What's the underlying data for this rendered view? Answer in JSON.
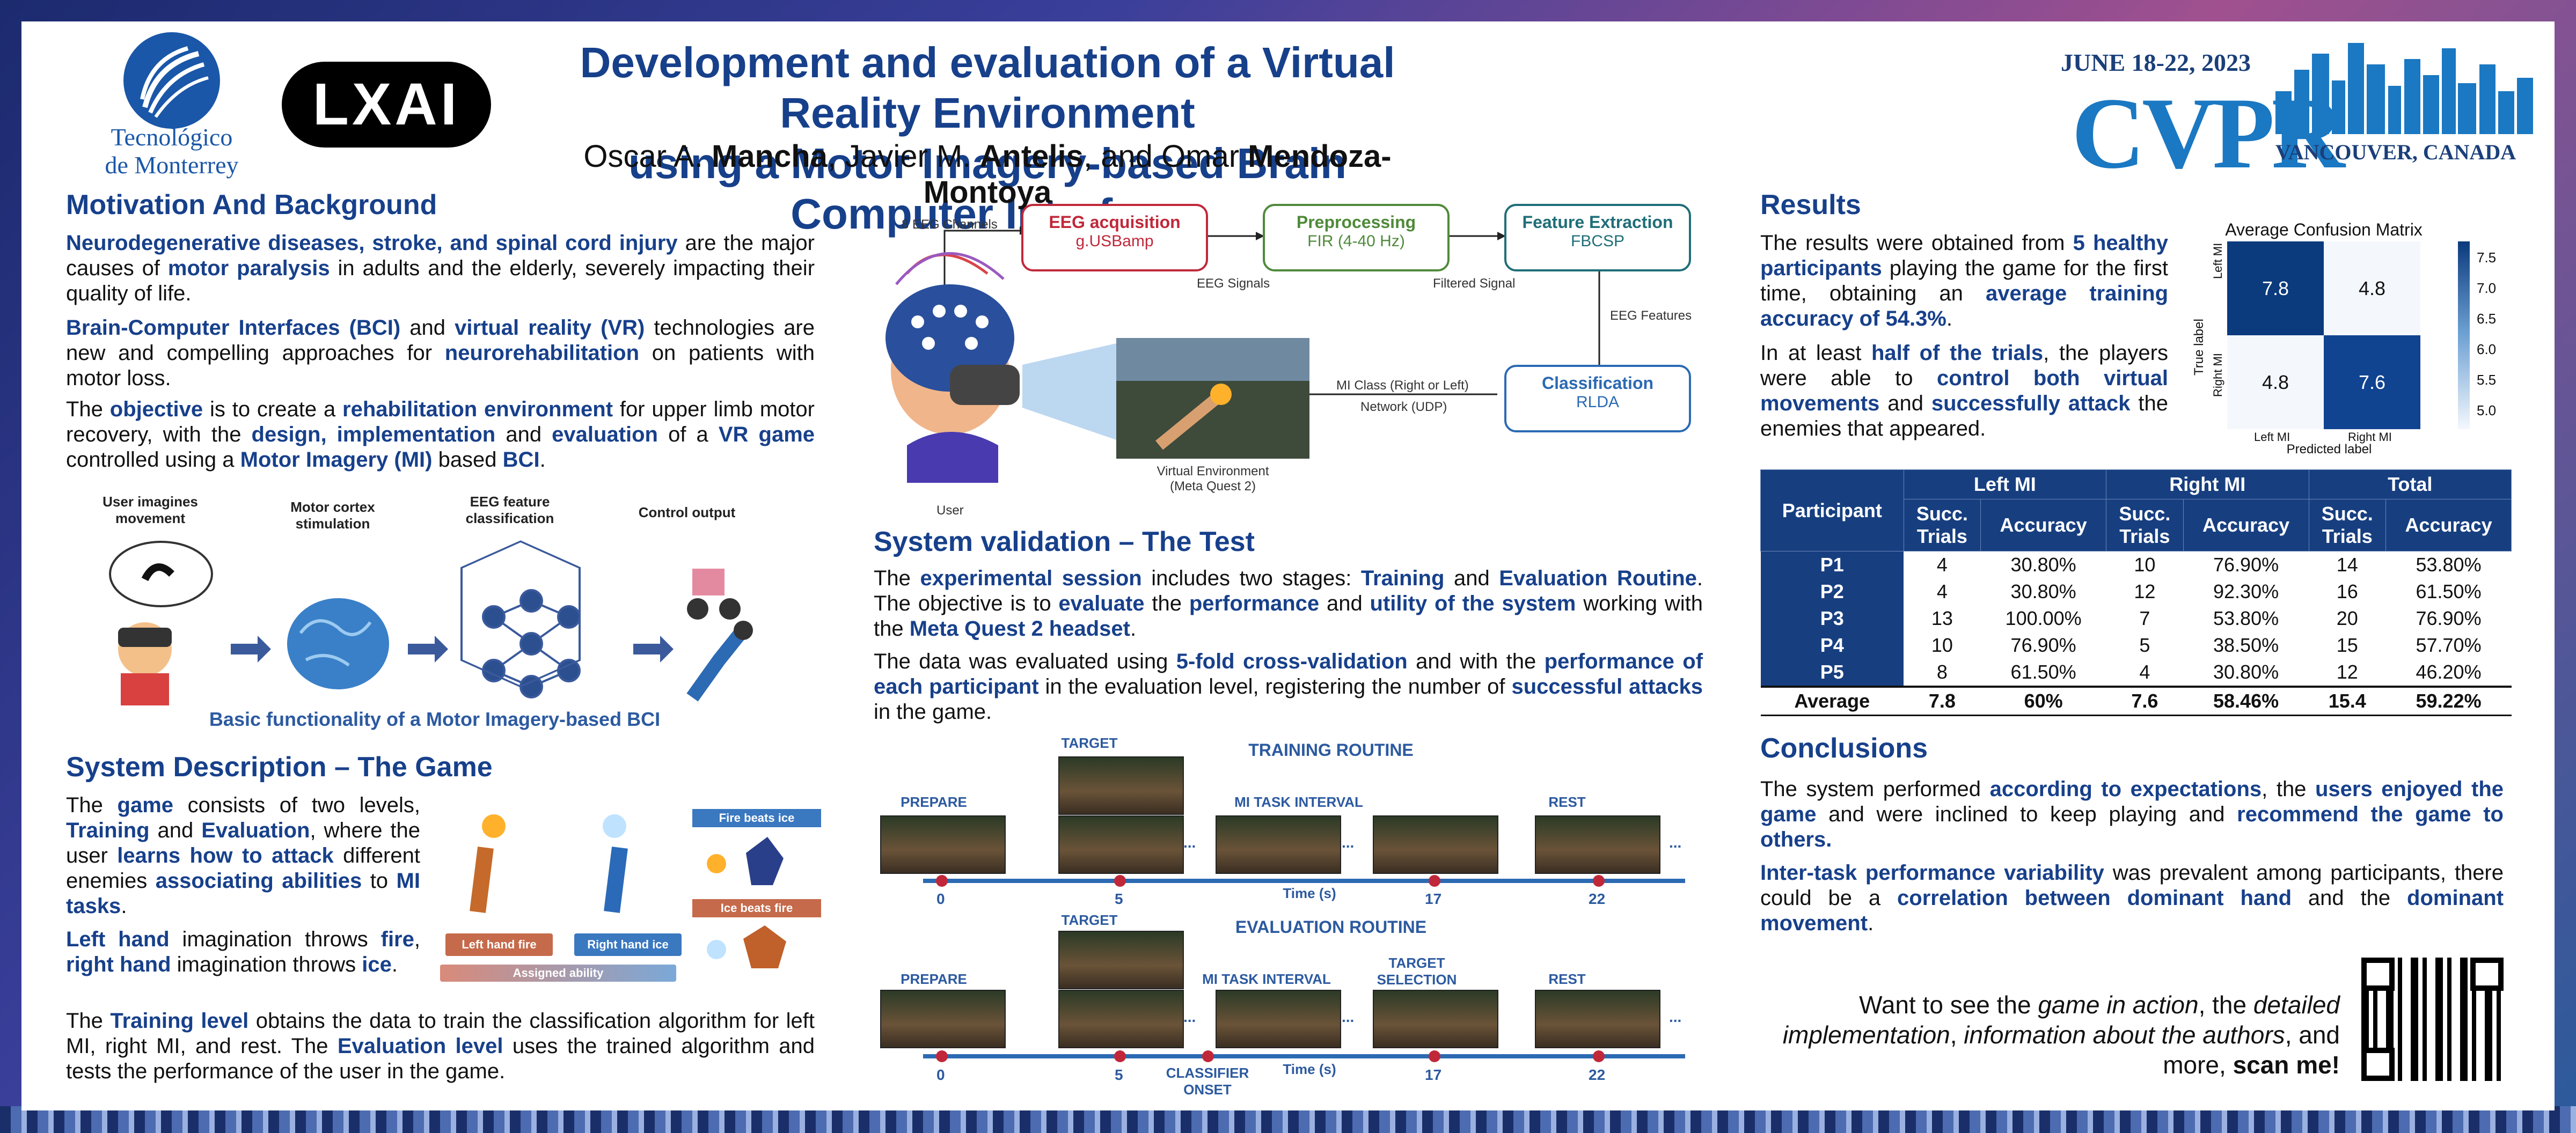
{
  "header": {
    "title_line1": "Development and evaluation of a Virtual Reality Environment",
    "title_line2": "using a Motor Imagery-based Brain Computer Interface",
    "authors": [
      {
        "first": "Oscar A.",
        "last": "Mancha"
      },
      {
        "first": "Javier M.",
        "last": "Antelis"
      },
      {
        "first": "Omar",
        "last": "Mendoza-Montoya"
      }
    ],
    "author_sep1": ", ",
    "author_sep2": ", and ",
    "logo_tec_line1": "Tecnológico",
    "logo_tec_line2": "de Monterrey",
    "logo_lxai": "LXAI",
    "conf_date": "JUNE 18-22, 2023",
    "conf_name": "CVPR",
    "conf_city": "VANCOUVER, CANADA"
  },
  "motivation": {
    "heading": "Motivation And Background",
    "p1_a": "Neurodegenerative diseases, stroke, and spinal cord injury",
    "p1_b": " are the major causes of ",
    "p1_c": "motor paralysis",
    "p1_d": " in adults and the elderly, severely impacting their quality of life.",
    "p2_a": "Brain-Computer Interfaces (BCI)",
    "p2_b": " and ",
    "p2_c": "virtual reality (VR)",
    "p2_d": " technologies are new and compelling approaches for ",
    "p2_e": "neurorehabilitation",
    "p2_f": " on patients with motor loss.",
    "p3_a": "The ",
    "p3_b": "objective",
    "p3_c": " is to create a ",
    "p3_d": "rehabilitation environment",
    "p3_e": " for upper limb motor recovery, with the ",
    "p3_f": "design, implementation",
    "p3_g": " and ",
    "p3_h": "evaluation",
    "p3_i": " of a ",
    "p3_j": "VR game",
    "p3_k": " controlled using a ",
    "p3_l": "Motor Imagery (MI)",
    "p3_m": " based ",
    "p3_n": "BCI",
    "p3_o": "."
  },
  "mi_figure": {
    "label1": "User imagines movement",
    "label2": "Motor cortex stimulation",
    "label3": "EEG feature classification",
    "label4": "Control output",
    "caption": "Basic functionality of a Motor Imagery-based BCI"
  },
  "game": {
    "heading": "System Description – The Game",
    "p1_a": "The ",
    "p1_b": "game",
    "p1_c": " consists of two levels, ",
    "p1_d": "Training",
    "p1_e": " and ",
    "p1_f": "Evaluation",
    "p1_g": ", where the user ",
    "p1_h": "learns how to attack",
    "p1_i": " different enemies ",
    "p1_j": "associating abilities",
    "p1_k": " to ",
    "p1_l": "MI tasks",
    "p1_m": ".",
    "p2_a": "Left hand",
    "p2_b": " imagination throws ",
    "p2_c": "fire",
    "p2_d": ", ",
    "p2_e": "right hand",
    "p2_f": " imagination throws ",
    "p2_g": "ice",
    "p2_h": ".",
    "p3_a": "The ",
    "p3_b": "Training level",
    "p3_c": " obtains the data to train the classification algorithm for left MI, right MI, and rest. The ",
    "p3_d": "Evaluation level",
    "p3_e": " uses the trained algorithm and tests the performance of the user in the game.",
    "fig_left": "Left hand fire",
    "fig_right": "Right hand ice",
    "fig_assigned": "Assigned ability",
    "fig_fire_beats": "Fire beats ice",
    "fig_ice_beats": "Ice beats fire"
  },
  "system": {
    "channels": "8 EEG Channels",
    "acq_title": "EEG acquisition",
    "acq_sub": "g.USBamp",
    "pre_title": "Preprocessing",
    "pre_sub": "FIR (4-40 Hz)",
    "feat_title": "Feature Extraction",
    "feat_sub": "FBCSP",
    "cls_title": "Classification",
    "cls_sub": "RLDA",
    "eeg_signals": "EEG Signals",
    "filtered": "Filtered Signal",
    "features": "EEG Features",
    "mi_class": "MI Class (Right or Left)",
    "network": "Network (UDP)",
    "vr_env": "Virtual Environment",
    "vr_dev": "(Meta Quest 2)",
    "user": "User",
    "colors": {
      "acq": "#c0283a",
      "pre": "#4f8a3a",
      "feat": "#1f6e78",
      "cls": "#2c6ab3"
    }
  },
  "validation": {
    "heading": "System validation – The Test",
    "p1_a": "The ",
    "p1_b": "experimental session",
    "p1_c": " includes two stages: ",
    "p1_d": "Training",
    "p1_e": " and ",
    "p1_f": "Evaluation Routine",
    "p1_g": ". The objective is to ",
    "p1_h": "evaluate",
    "p1_i": " the ",
    "p1_j": "performance",
    "p1_k": " and ",
    "p1_l": "utility of the system",
    "p1_m": " working with the ",
    "p1_n": "Meta Quest 2 headset",
    "p1_o": ".",
    "p2_a": "The data was evaluated using ",
    "p2_b": "5-fold cross-validation",
    "p2_c": " and with the ",
    "p2_d": "performance of each participant",
    "p2_e": " in the evaluation level, registering the number of ",
    "p2_f": "successful attacks",
    "p2_g": " in the game."
  },
  "routines": {
    "training_title": "TRAINING ROUTINE",
    "evaluation_title": "EVALUATION ROUTINE",
    "prepare": "PREPARE",
    "target": "TARGET",
    "mi_task": "MI TASK INTERVAL",
    "rest": "REST",
    "target_sel_1": "TARGET",
    "target_sel_2": "SELECTION",
    "classifier_1": "CLASSIFIER",
    "classifier_2": "ONSET",
    "time": "Time (s)",
    "ellipsis": "...",
    "ticks": [
      "0",
      "5",
      "17",
      "22"
    ]
  },
  "results": {
    "heading": "Results",
    "p1_a": "The results were obtained from ",
    "p1_b": "5 healthy participants",
    "p1_c": " playing the game for the first time, obtaining an ",
    "p1_d": "average training accuracy of 54.3%",
    "p1_e": ".",
    "p2_a": "In at least ",
    "p2_b": "half of the trials",
    "p2_c": ", the players were able to ",
    "p2_d": "control both virtual movements",
    "p2_e": " and ",
    "p2_f": "successfully attack",
    "p2_g": " the enemies that appeared.",
    "cm_title": "Average Confusion Matrix",
    "cm_ylabel": "True label",
    "cm_xlabel": "Predicted label",
    "cm_row_left": "Left MI",
    "cm_row_right": "Right MI",
    "cm_col_left": "Left MI",
    "cm_col_right": "Right MI",
    "cm_values": [
      [
        "7.8",
        "4.8"
      ],
      [
        "4.8",
        "7.6"
      ]
    ],
    "cm_colorbar": [
      "7.5",
      "7.0",
      "6.5",
      "6.0",
      "5.5",
      "5.0"
    ]
  },
  "table": {
    "participant": "Participant",
    "groups": [
      "Left MI",
      "Right MI",
      "Total"
    ],
    "succ_1": "Succ.",
    "succ_2": "Trials",
    "accuracy": "Accuracy",
    "rows": [
      [
        "P1",
        "4",
        "30.80%",
        "10",
        "76.90%",
        "14",
        "53.80%"
      ],
      [
        "P2",
        "4",
        "30.80%",
        "12",
        "92.30%",
        "16",
        "61.50%"
      ],
      [
        "P3",
        "13",
        "100.00%",
        "7",
        "53.80%",
        "20",
        "76.90%"
      ],
      [
        "P4",
        "10",
        "76.90%",
        "5",
        "38.50%",
        "15",
        "57.70%"
      ],
      [
        "P5",
        "8",
        "61.50%",
        "4",
        "30.80%",
        "12",
        "46.20%"
      ]
    ],
    "average": [
      "Average",
      "7.8",
      "60%",
      "7.6",
      "58.46%",
      "15.4",
      "59.22%"
    ]
  },
  "conclusions": {
    "heading": "Conclusions",
    "p1_a": "The system performed ",
    "p1_b": "according to expectations",
    "p1_c": ", the ",
    "p1_d": "users enjoyed the game",
    "p1_e": " and were inclined to keep playing and ",
    "p1_f": "recommend the game to others.",
    "p2_a": "Inter-task performance variability",
    "p2_b": " was prevalent among participants, there could be a ",
    "p2_c": "correlation between dominant hand",
    "p2_d": " and the ",
    "p2_e": "dominant movement",
    "p2_f": "."
  },
  "scan": {
    "a": "Want to see the ",
    "b": "game in action",
    "c": ", the ",
    "d": "detailed implementation",
    "e": ", ",
    "f": "information about the authors",
    "g": ", and more, ",
    "h": "scan me!"
  }
}
